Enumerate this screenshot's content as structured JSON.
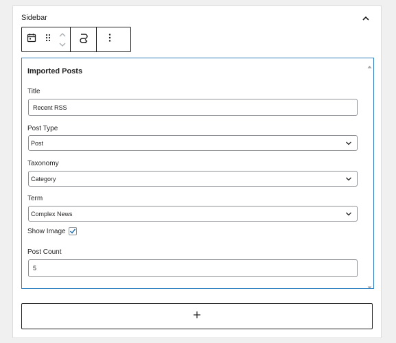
{
  "panel": {
    "title": "Sidebar",
    "collapse_icon": "chevron-up-icon"
  },
  "toolbar": {
    "block_type_icon": "calendar-icon",
    "drag_icon": "drag-handle-icon",
    "move_up_icon": "chevron-up-icon",
    "move_down_icon": "chevron-down-icon",
    "transform_icon": "loop-icon",
    "options_icon": "more-vertical-icon"
  },
  "block": {
    "title": "Imported Posts",
    "fields": {
      "title": {
        "label": "Title",
        "value": "Recent RSS"
      },
      "post_type": {
        "label": "Post Type",
        "value": "Post"
      },
      "taxonomy": {
        "label": "Taxonomy",
        "value": "Category"
      },
      "term": {
        "label": "Term",
        "value": "Complex News"
      },
      "show_image": {
        "label": "Show Image",
        "checked": true
      },
      "post_count": {
        "label": "Post Count",
        "value": "5"
      }
    }
  },
  "add_block": {
    "icon": "plus-icon"
  },
  "colors": {
    "accent": "#2e7fbf",
    "border": "#1e1e1e",
    "input_border": "#8c8f94",
    "background": "#f0f0f1"
  }
}
